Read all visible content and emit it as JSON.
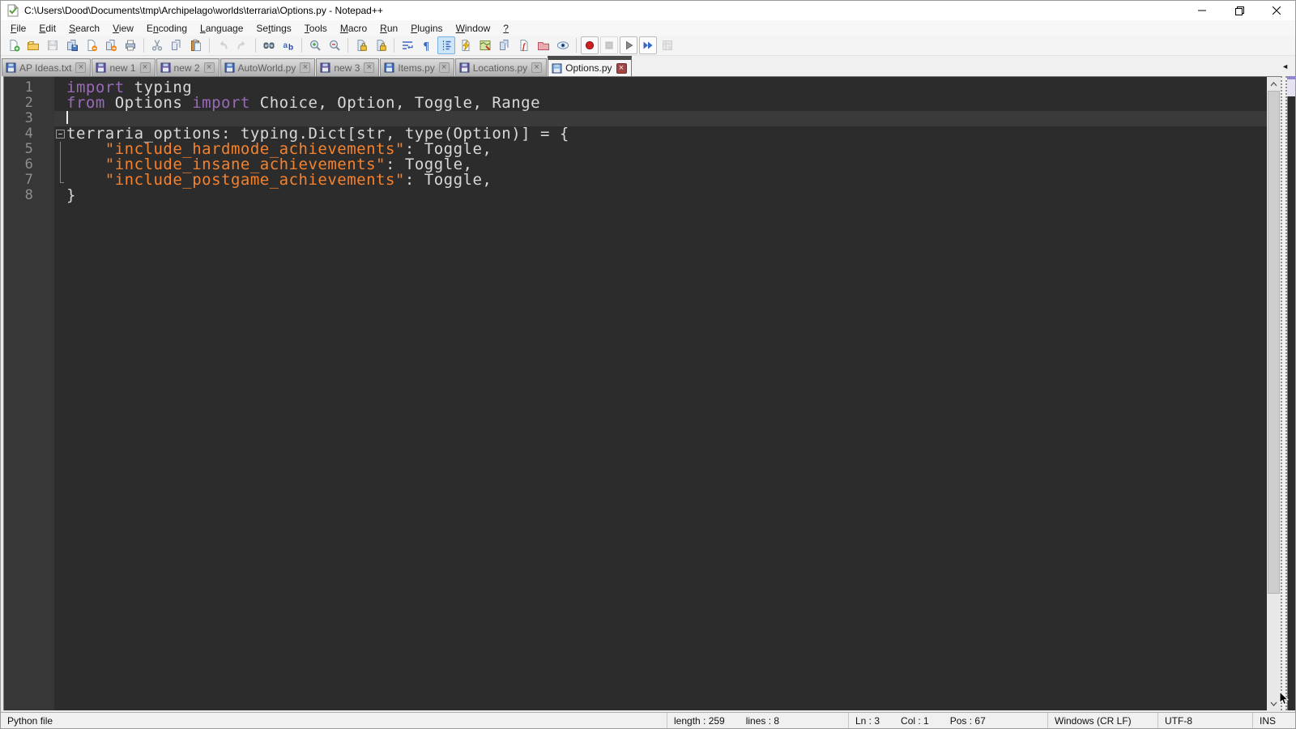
{
  "window": {
    "title": "C:\\Users\\Dood\\Documents\\tmp\\Archipelago\\worlds\\terraria\\Options.py - Notepad++"
  },
  "menu": {
    "items": [
      {
        "label": "File",
        "underline": 0
      },
      {
        "label": "Edit",
        "underline": 0
      },
      {
        "label": "Search",
        "underline": 0
      },
      {
        "label": "View",
        "underline": 0
      },
      {
        "label": "Encoding",
        "underline": 1
      },
      {
        "label": "Language",
        "underline": 0
      },
      {
        "label": "Settings",
        "underline": 2
      },
      {
        "label": "Tools",
        "underline": 0
      },
      {
        "label": "Macro",
        "underline": 0
      },
      {
        "label": "Run",
        "underline": 0
      },
      {
        "label": "Plugins",
        "underline": 0
      },
      {
        "label": "Window",
        "underline": 0
      },
      {
        "label": "?",
        "underline": 0
      }
    ]
  },
  "toolbar": {
    "groups": [
      [
        {
          "name": "new-file",
          "icon": "new"
        },
        {
          "name": "open",
          "icon": "open"
        },
        {
          "name": "save",
          "icon": "save",
          "disabled": true
        },
        {
          "name": "save-all",
          "icon": "saveall"
        },
        {
          "name": "close",
          "icon": "close"
        },
        {
          "name": "close-all",
          "icon": "closeall"
        },
        {
          "name": "print",
          "icon": "print"
        }
      ],
      [
        {
          "name": "cut",
          "icon": "cut"
        },
        {
          "name": "copy",
          "icon": "copy"
        },
        {
          "name": "paste",
          "icon": "paste"
        }
      ],
      [
        {
          "name": "undo",
          "icon": "undo",
          "disabled": true
        },
        {
          "name": "redo",
          "icon": "redo",
          "disabled": true
        }
      ],
      [
        {
          "name": "find",
          "icon": "find"
        },
        {
          "name": "replace",
          "icon": "replace"
        }
      ],
      [
        {
          "name": "zoom-in",
          "icon": "zoomin"
        },
        {
          "name": "zoom-out",
          "icon": "zoomout"
        }
      ],
      [
        {
          "name": "sync-vertical-scrolling",
          "icon": "synclock"
        },
        {
          "name": "sync-horizontal-scrolling",
          "icon": "synclock"
        }
      ],
      [
        {
          "name": "word-wrap",
          "icon": "wrap"
        },
        {
          "name": "show-all-characters",
          "icon": "pilcrow"
        },
        {
          "name": "show-indent-guide",
          "icon": "indent",
          "active": true
        },
        {
          "name": "plugin-execute",
          "icon": "bolt"
        },
        {
          "name": "document-map",
          "icon": "map"
        },
        {
          "name": "document-list",
          "icon": "doclist"
        },
        {
          "name": "function-list",
          "icon": "funclist"
        },
        {
          "name": "folder-as-workspace",
          "icon": "folderws"
        },
        {
          "name": "monitoring",
          "icon": "eye"
        }
      ],
      [
        {
          "name": "macro-record",
          "icon": "record",
          "boxed": true
        },
        {
          "name": "macro-stop",
          "icon": "stop",
          "boxed": true,
          "disabled": true
        },
        {
          "name": "macro-playback",
          "icon": "play",
          "boxed": true
        },
        {
          "name": "macro-run-multiple",
          "icon": "ffwd",
          "boxed": true
        },
        {
          "name": "macro-save",
          "icon": "savemacro",
          "disabled": true
        }
      ]
    ]
  },
  "tabs": [
    {
      "label": "AP Ideas.txt",
      "modified": false,
      "active": false
    },
    {
      "label": "new 1",
      "modified": true,
      "active": false
    },
    {
      "label": "new 2",
      "modified": true,
      "active": false
    },
    {
      "label": "AutoWorld.py",
      "modified": false,
      "active": false
    },
    {
      "label": "new 3",
      "modified": true,
      "active": false
    },
    {
      "label": "Items.py",
      "modified": false,
      "active": false
    },
    {
      "label": "Locations.py",
      "modified": true,
      "active": false
    },
    {
      "label": "Options.py",
      "modified": false,
      "active": true
    }
  ],
  "editor": {
    "lines": [
      {
        "num": "1",
        "tokens": [
          {
            "t": "kw",
            "v": "import"
          },
          {
            "t": "d",
            "v": " typing"
          }
        ]
      },
      {
        "num": "2",
        "tokens": [
          {
            "t": "kw",
            "v": "from"
          },
          {
            "t": "d",
            "v": " Options "
          },
          {
            "t": "kw",
            "v": "import"
          },
          {
            "t": "d",
            "v": " Choice, Option, Toggle, Range"
          }
        ]
      },
      {
        "num": "3",
        "tokens": [],
        "current": true,
        "caret": true
      },
      {
        "num": "4",
        "tokens": [
          {
            "t": "d",
            "v": "terraria_options: typing.Dict[str, type(Option)] = {"
          }
        ],
        "fold": "minus"
      },
      {
        "num": "5",
        "tokens": [
          {
            "t": "d",
            "v": "    "
          },
          {
            "t": "str",
            "v": "\"include_hardmode_achievements\""
          },
          {
            "t": "d",
            "v": ": Toggle,"
          }
        ],
        "fold": "line"
      },
      {
        "num": "6",
        "tokens": [
          {
            "t": "d",
            "v": "    "
          },
          {
            "t": "str",
            "v": "\"include_insane_achievements\""
          },
          {
            "t": "d",
            "v": ": Toggle,"
          }
        ],
        "fold": "line"
      },
      {
        "num": "7",
        "tokens": [
          {
            "t": "d",
            "v": "    "
          },
          {
            "t": "str",
            "v": "\"include_postgame_achievements\""
          },
          {
            "t": "d",
            "v": ": Toggle,"
          }
        ],
        "fold": "corner"
      },
      {
        "num": "8",
        "tokens": [
          {
            "t": "d",
            "v": "}"
          }
        ]
      }
    ]
  },
  "status_bar": {
    "doc_type": "Python file",
    "length": "length : 259",
    "lines": "lines : 8",
    "line": "Ln : 3",
    "column": "Col : 1",
    "position": "Pos : 67",
    "eol": "Windows (CR LF)",
    "encoding": "UTF-8",
    "typing_mode": "INS"
  },
  "colors": {
    "keyword": "#9B69B9",
    "string": "#F5822E",
    "default_text": "#D8D8D8",
    "editor_bg": "#2C2C2C",
    "gutter_bg": "#373737",
    "current_line_bg": "#3A3A3A",
    "line_number": "#8E8E8E",
    "active_tab_top": "#4A4A4A",
    "saved_floppy": "#3F6FC0",
    "modified_floppy": "#6C56A0",
    "active_floppy": "#7FB0E0"
  }
}
